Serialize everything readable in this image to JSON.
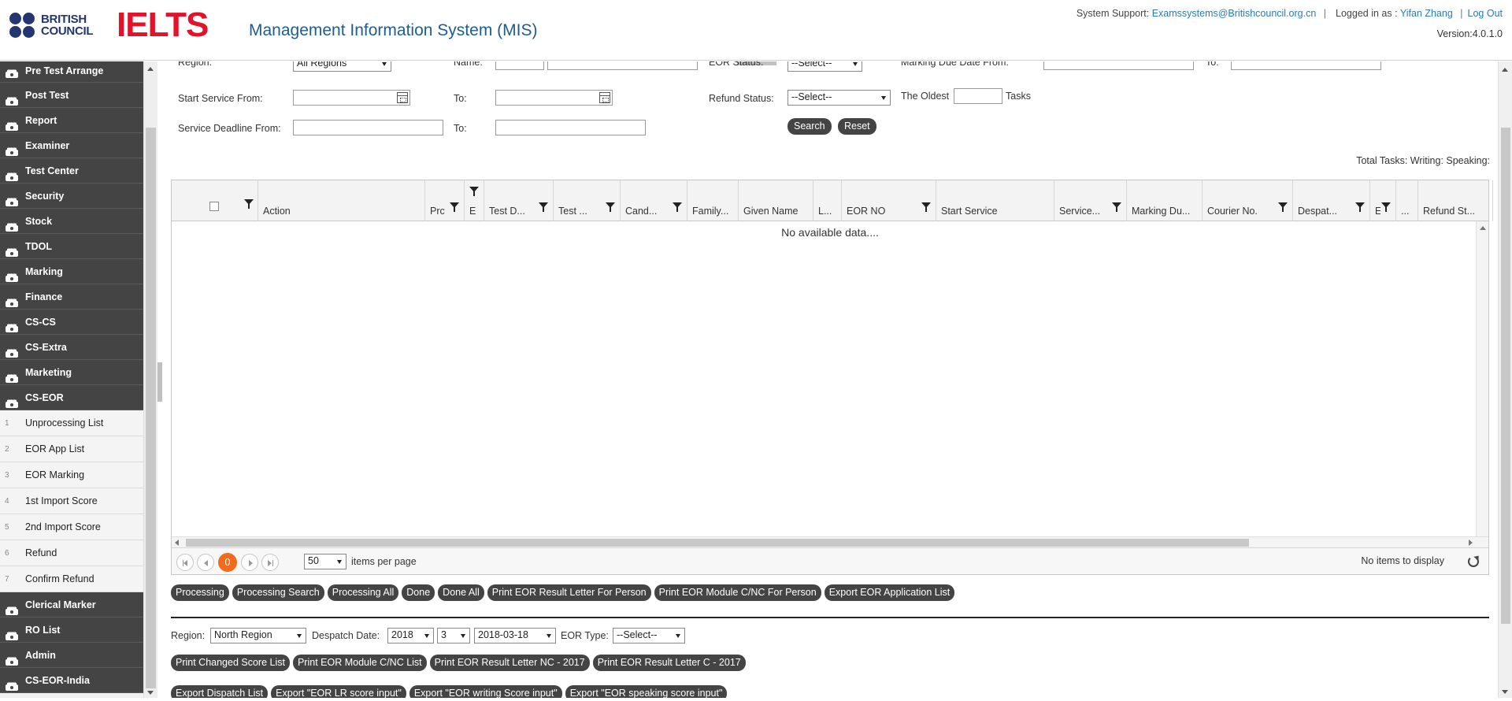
{
  "header": {
    "bc_logo_line1": "BRITISH",
    "bc_logo_line2": "COUNCIL",
    "ielts_logo": "IELTS",
    "title": "Management Information System (MIS)",
    "support_label": "System Support:",
    "support_email": "Examssystems@Britishcouncil.org.cn",
    "logged_in_label": "Logged in as :",
    "user_name": "Yifan Zhang",
    "logout": "Log Out",
    "separator": "|",
    "version": "Version:4.0.1.0"
  },
  "sidebar": {
    "menu": [
      {
        "label": "Pre Test Arrange"
      },
      {
        "label": "Post Test"
      },
      {
        "label": "Report"
      },
      {
        "label": "Examiner"
      },
      {
        "label": "Test Center"
      },
      {
        "label": "Security"
      },
      {
        "label": "Stock"
      },
      {
        "label": "TDOL"
      },
      {
        "label": "Marking"
      },
      {
        "label": "Finance"
      },
      {
        "label": "CS-CS"
      },
      {
        "label": "CS-Extra"
      },
      {
        "label": "Marketing"
      },
      {
        "label": "CS-EOR"
      }
    ],
    "submenu": [
      {
        "num": "1",
        "label": "Unprocessing List"
      },
      {
        "num": "2",
        "label": "EOR App List"
      },
      {
        "num": "3",
        "label": "EOR Marking"
      },
      {
        "num": "4",
        "label": "1st Import Score"
      },
      {
        "num": "5",
        "label": "2nd Import Score"
      },
      {
        "num": "6",
        "label": "Refund"
      },
      {
        "num": "7",
        "label": "Confirm Refund"
      }
    ],
    "menu_after": [
      {
        "label": "Clerical Marker"
      },
      {
        "label": "RO List"
      },
      {
        "label": "Admin"
      },
      {
        "label": "CS-EOR-India"
      }
    ]
  },
  "filters": {
    "region_label": "Region:",
    "region_value": "All Regions",
    "name_label": "Name:",
    "eor_status_label": "EOR Status:",
    "eor_status_value": "--Select--",
    "marking_due_from_label": "Marking Due Date From:",
    "to_label": "To:",
    "start_service_from_label": "Start Service From:",
    "refund_status_label": "Refund Status:",
    "refund_status_value": "--Select--",
    "oldest_label": "The Oldest",
    "tasks_label": "Tasks",
    "service_deadline_from_label": "Service Deadline From:",
    "search_button": "Search",
    "reset_button": "Reset",
    "total_tasks": "Total Tasks: Writing: Speaking:"
  },
  "grid": {
    "columns": [
      {
        "label": ""
      },
      {
        "label": "Action"
      },
      {
        "label": "Prc"
      },
      {
        "label": "E"
      },
      {
        "label": "Test D..."
      },
      {
        "label": "Test ..."
      },
      {
        "label": "Cand..."
      },
      {
        "label": "Family..."
      },
      {
        "label": "Given Name"
      },
      {
        "label": "L..."
      },
      {
        "label": "EOR NO"
      },
      {
        "label": "Start Service"
      },
      {
        "label": "Service..."
      },
      {
        "label": "Marking Du..."
      },
      {
        "label": "Courier No."
      },
      {
        "label": "Despat..."
      },
      {
        "label": "EC"
      },
      {
        "label": "..."
      },
      {
        "label": "Refund St..."
      }
    ],
    "empty_message": "No available data....",
    "page_size": "50",
    "items_per_page": "items per page",
    "current_page": "0",
    "no_items": "No items to display"
  },
  "actions": [
    "Processing",
    "Processing Search",
    "Processing All",
    "Done",
    "Done All",
    "Print EOR Result Letter For Person",
    "Print EOR Module C/NC For Person",
    "Export EOR Application List"
  ],
  "dispatch": {
    "region_label": "Region:",
    "region_value": "North Region",
    "despatch_date_label": "Despatch Date:",
    "year_value": "2018",
    "month_value": "3",
    "date_value": "2018-03-18",
    "eor_type_label": "EOR Type:",
    "eor_type_value": "--Select--",
    "print_buttons": [
      "Print Changed Score List",
      "Print EOR Module C/NC List",
      "Print EOR Result Letter NC - 2017",
      "Print EOR Result Letter C - 2017"
    ],
    "export_buttons": [
      "Export Dispatch List",
      "Export \"EOR LR score input\"",
      "Export \"EOR writing Score input\"",
      "Export \"EOR speaking score input\""
    ]
  },
  "colors": {
    "sidebar_dark": "#444444",
    "brand_blue": "#23366f",
    "ielts_red": "#e3122b",
    "link_blue": "#2a7ab8",
    "pager_orange": "#f06b1b"
  }
}
